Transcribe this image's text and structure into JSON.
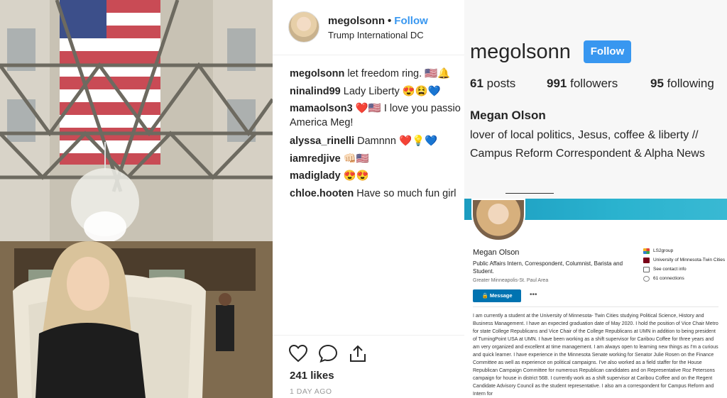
{
  "post": {
    "username": "megolsonn",
    "separator": "•",
    "follow_label": "Follow",
    "location": "Trump International DC",
    "comments": [
      {
        "user": "megolsonn",
        "text": "let freedom ring. 🇺🇸🔔"
      },
      {
        "user": "ninalind99",
        "text": "Lady Liberty 😍😫💙"
      },
      {
        "user": "mamaolson3",
        "text": "❤️🇺🇸 I love you passio America Meg!"
      },
      {
        "user": "alyssa_rinelli",
        "text": "Damnnn ❤️💡💙"
      },
      {
        "user": "iamredjive",
        "text": "👊🏻🇺🇸"
      },
      {
        "user": "madiglady",
        "text": "😍😍"
      },
      {
        "user": "chloe.hooten",
        "text": "Have so much fun girl"
      }
    ],
    "likes": "241 likes",
    "time": "1 DAY AGO"
  },
  "profile": {
    "username": "megolsonn",
    "follow_label": "Follow",
    "posts_count": "61",
    "posts_label": "posts",
    "followers_count": "991",
    "followers_label": "followers",
    "following_count": "95",
    "following_label": "following",
    "full_name": "Megan Olson",
    "bio_line1": "lover of local politics, Jesus, coffee & liberty //",
    "bio_line2": "Campus Reform Correspondent & Alpha News"
  },
  "linkedin": {
    "name": "Megan Olson",
    "headline": "Public Affairs Intern, Correspondent, Columnist, Barista and Student.",
    "location": "Greater Minneapolis-St. Paul Area",
    "message_label": "Message",
    "more_label": "•••",
    "company": "LS2group",
    "school": "University of Minnesota-Twin Cities",
    "contact_label": "See contact info",
    "connections": "61 connections",
    "about": "I am currently a student at the University of Minnesota- Twin Cities studying Political Science, History and Business Management. I have an expected graduation date of May 2020. I hold the position of Vice Chair Metro for state College Republicans and Vice Chair of the College Republicans at UMN in addition to being president of TurningPoint USA at UMN. I have been working as a shift supervisor for Caribou Coffee for three years and am very organized and excellent at time management. I am always open to learning new things as I'm a curious and quick learner. I have experience in the Minnesota Senate working for Senator Julie Rosen on the Finance Committee as well as experience on political campaigns. I've also worked as a field staffer for the House Republican Campaign Committee for numerous Republican candidates and on Representative Roz Petersons campaign for house in district 56B. I currently work as a shift supervisor at Caribou Coffee and on the Regent Candidate Advisory Council as the student representative. I also am a correspondent for Campus Reform and Intern for"
  },
  "colors": {
    "instagram_blue": "#3897f0",
    "linkedin_blue": "#0073b1",
    "linkedin_banner": "#2bb3cf"
  }
}
